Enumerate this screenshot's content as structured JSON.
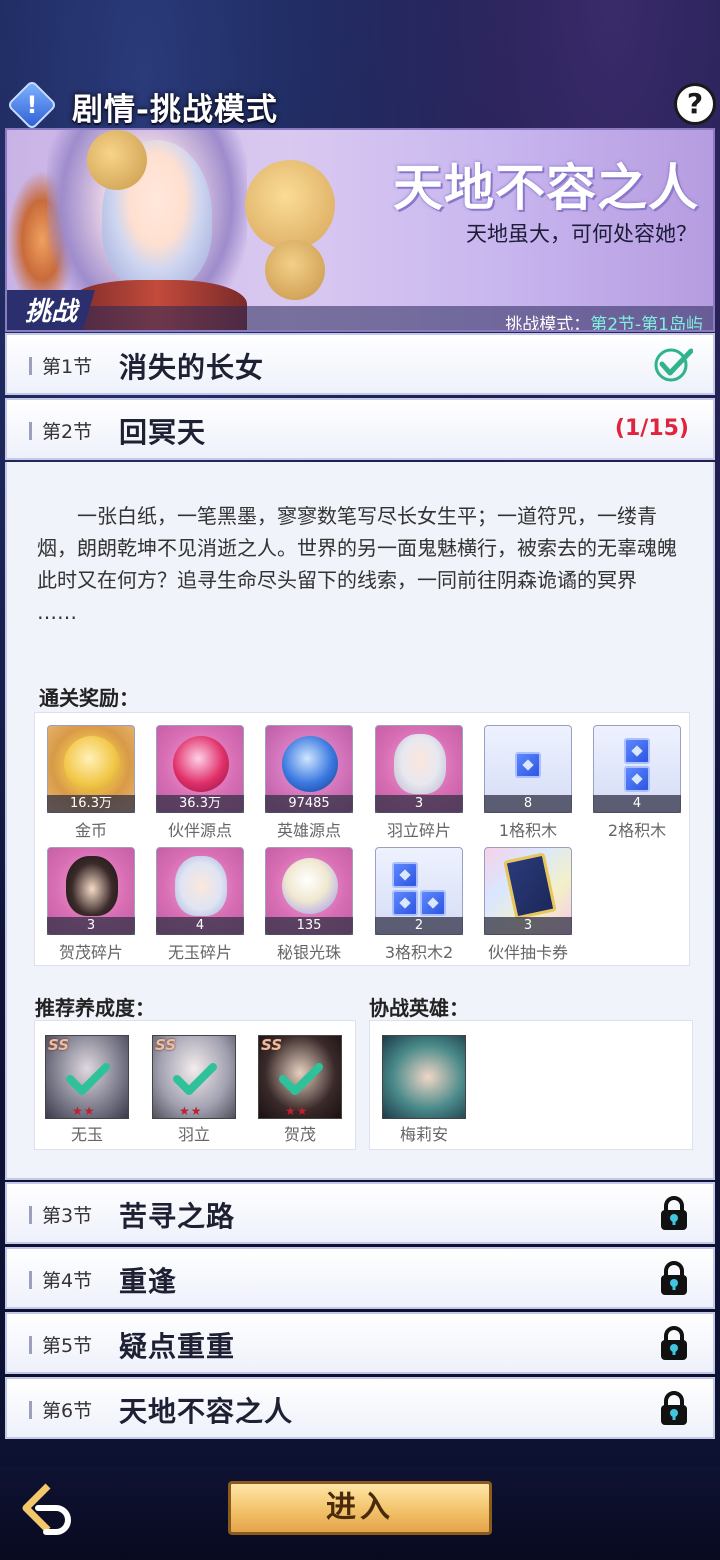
{
  "header": {
    "title": "剧情-挑战模式",
    "help_symbol": "?",
    "alert_symbol": "!"
  },
  "banner": {
    "title": "天地不容之人",
    "subtitle": "天地虽大，可何处容她？",
    "tag": "挑战",
    "mode_prefix": "挑战模式：",
    "mode_value": "第2节-第1岛屿"
  },
  "sections": [
    {
      "num": "第1节",
      "name": "消失的长女",
      "status": "completed"
    },
    {
      "num": "第2节",
      "name": "回冥天",
      "progress": "(1/15)",
      "status": "active"
    },
    {
      "num": "第3节",
      "name": "苦寻之路",
      "status": "locked"
    },
    {
      "num": "第4节",
      "name": "重逢",
      "status": "locked"
    },
    {
      "num": "第5节",
      "name": "疑点重重",
      "status": "locked"
    },
    {
      "num": "第6节",
      "name": "天地不容之人",
      "status": "locked"
    }
  ],
  "story": {
    "text": "一张白纸，一笔黑墨，寥寥数笔写尽长女生平；一道符咒，一缕青烟，朗朗乾坤不见消逝之人。世界的另一面鬼魅横行，被索去的无辜魂魄此时又在何方？追寻生命尽头留下的线索，一同前往阴森诡谲的冥界",
    "ellipsis": "……"
  },
  "rewards_title": "通关奖励：",
  "rewards": [
    {
      "label": "金币",
      "qty": "16.3万",
      "icon": "gold-coin"
    },
    {
      "label": "伙伴源点",
      "qty": "36.3万",
      "icon": "partner-orb"
    },
    {
      "label": "英雄源点",
      "qty": "97485",
      "icon": "hero-orb"
    },
    {
      "label": "羽立碎片",
      "qty": "3",
      "icon": "yuli-puzzle"
    },
    {
      "label": "1格积木",
      "qty": "8",
      "icon": "block-1"
    },
    {
      "label": "2格积木",
      "qty": "4",
      "icon": "block-2"
    },
    {
      "label": "贺茂碎片",
      "qty": "3",
      "icon": "hemao-puzzle"
    },
    {
      "label": "无玉碎片",
      "qty": "4",
      "icon": "wuyu-puzzle"
    },
    {
      "label": "秘银光珠",
      "qty": "135",
      "icon": "mithril-pearl"
    },
    {
      "label": "3格积木2",
      "qty": "2",
      "icon": "block-3"
    },
    {
      "label": "伙伴抽卡券",
      "qty": "3",
      "icon": "draw-card"
    }
  ],
  "recommend_title": "推荐养成度：",
  "recommend_heroes": [
    {
      "name": "无玉",
      "grade": "SS",
      "stars": "★★"
    },
    {
      "name": "羽立",
      "grade": "SS",
      "stars": "★★"
    },
    {
      "name": "贺茂",
      "grade": "SS",
      "stars": "★★"
    }
  ],
  "assist_title": "协战英雄：",
  "assist_heroes": [
    {
      "name": "梅莉安"
    }
  ],
  "bottom": {
    "enter_label": "进入"
  },
  "colors": {
    "progress": "#e0243c",
    "check": "#2fb38a",
    "mode_highlight": "#7ff0e0"
  }
}
